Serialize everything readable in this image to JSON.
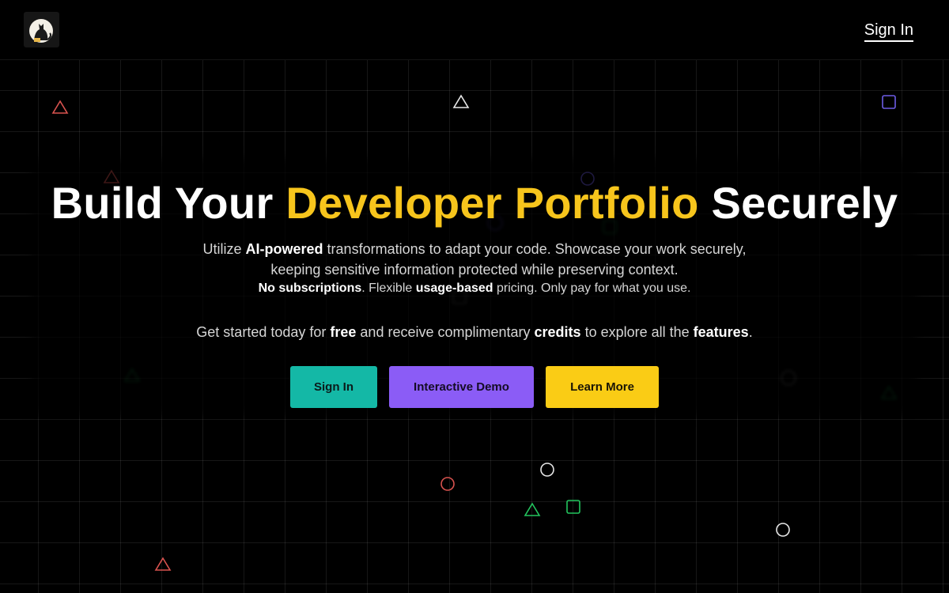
{
  "header": {
    "logo_alt": "cat-logo",
    "signin_label": "Sign In"
  },
  "hero": {
    "title_part1": "Build Your ",
    "title_accent": "Developer Portfolio",
    "title_part2": " Securely",
    "desc_1": "Utilize ",
    "desc_bold_1": "AI-powered",
    "desc_2": " transformations to adapt your code. Showcase your work securely, keeping sensitive information protected while preserving context.",
    "note_bold_1": "No subscriptions",
    "note_1": ". Flexible ",
    "note_bold_2": "usage-based",
    "note_2": " pricing. Only pay for what you use.",
    "cta_1": "Get started today for ",
    "cta_bold_1": "free",
    "cta_2": " and receive complimentary ",
    "cta_bold_2": "credits",
    "cta_3": " to explore all the ",
    "cta_bold_3": "features",
    "cta_4": "."
  },
  "buttons": {
    "signin": "Sign In",
    "demo": "Interactive Demo",
    "learn": "Learn More"
  },
  "colors": {
    "accent_yellow": "#f7c51c",
    "teal": "#14b8a6",
    "purple": "#8b5cf6",
    "yellow": "#facc15",
    "background": "#000000"
  }
}
